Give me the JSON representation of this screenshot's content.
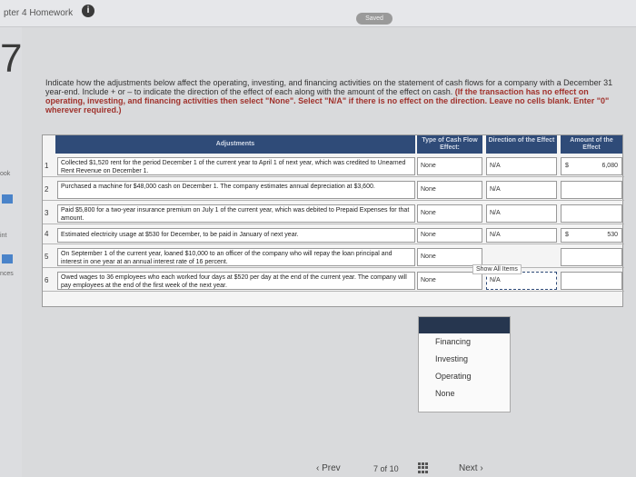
{
  "header": {
    "chapter": "pter 4 Homework",
    "info_symbol": "i",
    "saved": "Saved"
  },
  "side": {
    "label1": "ook",
    "label2": "int",
    "label3": "nces"
  },
  "question_number": "7",
  "instructions": {
    "text": "Indicate how the adjustments below affect the operating, investing, and financing activities on the statement of cash flows for a company with a December 31 year-end. Include + or – to indicate the direction of the effect of each along with the amount of the effect on cash.",
    "bold": "(If the transaction has no effect on operating, investing, and financing activities then select \"None\". Select \"N/A\" if there is no effect on the direction. Leave no cells blank. Enter \"0\" wherever required.)"
  },
  "table": {
    "headers": {
      "adjustments": "Adjustments",
      "type": "Type of Cash Flow Effect:",
      "direction": "Direction of the Effect",
      "amount": "Amount of the Effect"
    },
    "rows": [
      {
        "num": "1",
        "text": "Collected $1,520 rent for the period December 1 of the current year to April 1 of next year, which was credited to Unearned Rent Revenue on December 1.",
        "type": "None",
        "direction": "N/A",
        "dollar": "$",
        "amount": "6,080"
      },
      {
        "num": "2",
        "text": "Purchased a machine for $48,000 cash on December 1. The company estimates annual depreciation at $3,600.",
        "type": "None",
        "direction": "N/A",
        "dollar": "",
        "amount": ""
      },
      {
        "num": "3",
        "text": "Paid $5,800 for a two-year insurance premium on July 1 of the current year, which was debited to Prepaid Expenses for that amount.",
        "type": "None",
        "direction": "N/A",
        "dollar": "",
        "amount": ""
      },
      {
        "num": "4",
        "text": "Estimated electricity usage at $530 for December, to be paid in January of next year.",
        "type": "None",
        "direction": "N/A",
        "dollar": "$",
        "amount": "530"
      },
      {
        "num": "5",
        "text": "On September 1 of the current year, loaned $10,000 to an officer of the company who will repay the loan principal and interest in one year at an annual interest rate of 16 percent.",
        "type": "None",
        "direction": "",
        "dollar": "",
        "amount": ""
      },
      {
        "num": "6",
        "text": "Owed wages to 36 employees who each worked four days at $520 per day at the end of the current year. The company will pay employees at the end of the first week of the next year.",
        "type": "None",
        "direction": "N/A",
        "dollar": "",
        "amount": ""
      }
    ],
    "show_all": "Show All Items"
  },
  "dropdown": {
    "options": [
      "Financing",
      "Investing",
      "Operating",
      "None"
    ]
  },
  "footer": {
    "prev": "‹ Prev",
    "page_current": "7",
    "page_of": "of",
    "page_total": "10",
    "next": "Next ›"
  }
}
